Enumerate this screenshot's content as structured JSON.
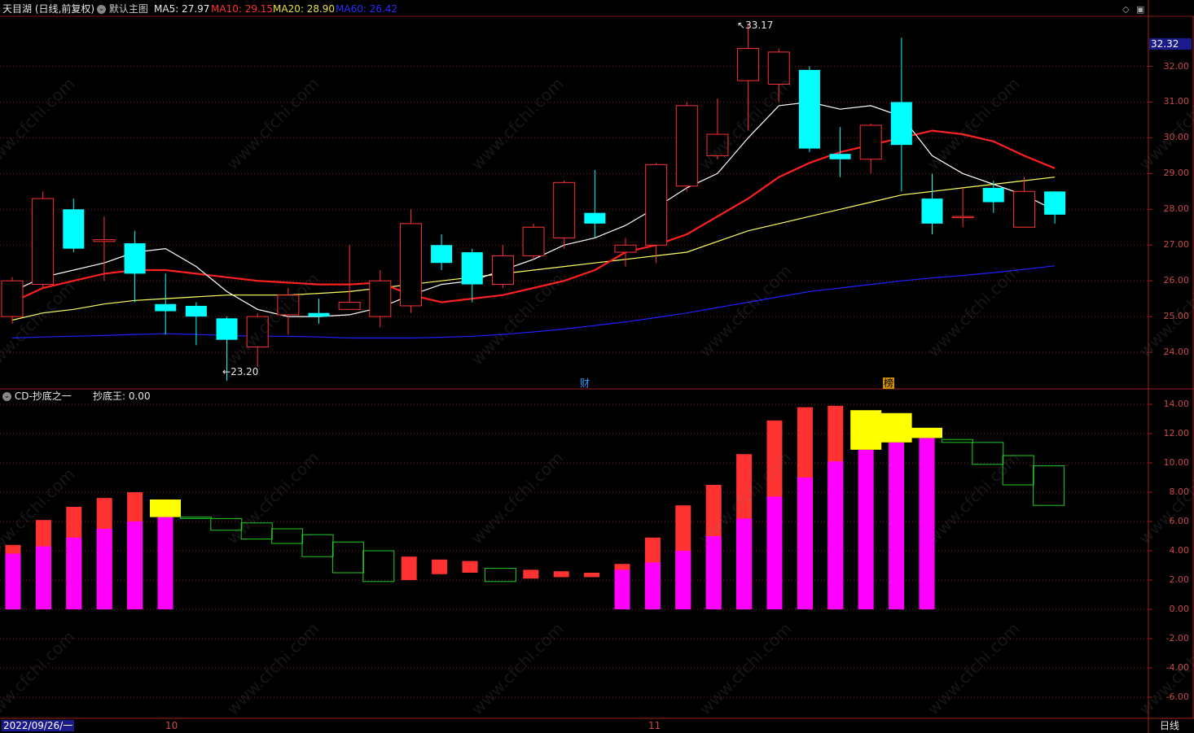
{
  "header": {
    "stock_name": "天目湖",
    "period": "(日线,前复权)",
    "main_chart_label": "默认主图",
    "ma5_label": "MA5: 27.97",
    "ma10_label": "MA10: 29.15",
    "ma20_label": "MA20: 28.90",
    "ma60_label": "MA60: 26.42"
  },
  "indicator": {
    "name": "CD-抄底之一",
    "value_label": "抄底王: 0.00"
  },
  "annotations": {
    "high": "33.17",
    "low": "23.20",
    "current_price": "32.32",
    "marker_cai": "财",
    "marker_bang": "榜"
  },
  "footer": {
    "date": "2022/09/26/一",
    "month_oct": "10",
    "month_nov": "11",
    "period_tab": "日线"
  },
  "price_axis": [
    "32.00",
    "31.00",
    "30.00",
    "29.00",
    "28.00",
    "27.00",
    "26.00",
    "25.00",
    "24.00"
  ],
  "indicator_axis": [
    "14.00",
    "12.00",
    "10.00",
    "8.00",
    "6.00",
    "4.00",
    "2.00",
    "0.00",
    "-2.00",
    "-4.00",
    "-6.00"
  ],
  "watermark": "www.cfchi.com",
  "colors": {
    "background": "#000000",
    "up": "#ff3232",
    "down": "#00ffff",
    "ma5": "#ffffff",
    "ma10": "#ff2020",
    "ma20": "#ffff60",
    "ma60": "#2020ff",
    "magenta": "#ff00ff",
    "yellow": "#ffff00",
    "green": "#22cc22",
    "grid": "#7a1818"
  },
  "chart_data": [
    {
      "type": "candlestick",
      "title": "天目湖 (日线,前复权)",
      "candles": [
        {
          "o": 25.0,
          "h": 26.1,
          "l": 24.8,
          "c": 26.0
        },
        {
          "o": 25.9,
          "h": 28.5,
          "l": 25.8,
          "c": 28.3
        },
        {
          "o": 28.0,
          "h": 28.3,
          "l": 26.8,
          "c": 26.9
        },
        {
          "o": 27.1,
          "h": 27.8,
          "l": 26.0,
          "c": 27.15
        },
        {
          "o": 27.05,
          "h": 27.4,
          "l": 25.4,
          "c": 26.2
        },
        {
          "o": 25.35,
          "h": 26.2,
          "l": 24.5,
          "c": 25.15
        },
        {
          "o": 25.3,
          "h": 25.4,
          "l": 24.2,
          "c": 25.0
        },
        {
          "o": 24.95,
          "h": 25.0,
          "l": 23.2,
          "c": 24.35
        },
        {
          "o": 24.15,
          "h": 25.1,
          "l": 23.6,
          "c": 25.0
        },
        {
          "o": 25.05,
          "h": 25.8,
          "l": 24.5,
          "c": 25.6
        },
        {
          "o": 25.1,
          "h": 25.5,
          "l": 24.8,
          "c": 25.0
        },
        {
          "o": 25.2,
          "h": 27.0,
          "l": 25.2,
          "c": 25.4
        },
        {
          "o": 25.0,
          "h": 26.3,
          "l": 24.7,
          "c": 26.0
        },
        {
          "o": 25.3,
          "h": 28.0,
          "l": 25.1,
          "c": 27.6
        },
        {
          "o": 27.0,
          "h": 27.3,
          "l": 26.3,
          "c": 26.5
        },
        {
          "o": 26.8,
          "h": 26.9,
          "l": 25.4,
          "c": 25.9
        },
        {
          "o": 25.9,
          "h": 27.0,
          "l": 25.8,
          "c": 26.7
        },
        {
          "o": 26.7,
          "h": 27.6,
          "l": 26.6,
          "c": 27.5
        },
        {
          "o": 27.2,
          "h": 28.8,
          "l": 26.9,
          "c": 28.75
        },
        {
          "o": 27.9,
          "h": 29.1,
          "l": 27.2,
          "c": 27.6
        },
        {
          "o": 26.8,
          "h": 27.2,
          "l": 26.4,
          "c": 27.0
        },
        {
          "o": 27.0,
          "h": 29.3,
          "l": 26.5,
          "c": 29.25
        },
        {
          "o": 28.65,
          "h": 31.0,
          "l": 28.5,
          "c": 30.9
        },
        {
          "o": 29.5,
          "h": 31.1,
          "l": 29.4,
          "c": 30.1
        },
        {
          "o": 31.6,
          "h": 33.17,
          "l": 30.2,
          "c": 32.5
        },
        {
          "o": 31.5,
          "h": 32.5,
          "l": 31.0,
          "c": 32.4
        },
        {
          "o": 31.9,
          "h": 32.0,
          "l": 29.6,
          "c": 29.7
        },
        {
          "o": 29.55,
          "h": 30.3,
          "l": 28.9,
          "c": 29.4
        },
        {
          "o": 29.4,
          "h": 30.4,
          "l": 29.0,
          "c": 30.35
        },
        {
          "o": 31.0,
          "h": 32.8,
          "l": 28.5,
          "c": 29.8
        },
        {
          "o": 28.3,
          "h": 29.0,
          "l": 27.3,
          "c": 27.6
        },
        {
          "o": 27.8,
          "h": 28.6,
          "l": 27.5,
          "c": 27.8
        },
        {
          "o": 28.6,
          "h": 28.8,
          "l": 27.9,
          "c": 28.2
        },
        {
          "o": 27.5,
          "h": 28.9,
          "l": 27.5,
          "c": 28.5
        },
        {
          "o": 28.5,
          "h": 28.5,
          "l": 27.6,
          "c": 27.85
        }
      ],
      "ma5": [
        25.7,
        26.1,
        26.3,
        26.5,
        26.8,
        26.9,
        26.4,
        25.7,
        25.2,
        25.0,
        25.0,
        25.05,
        25.25,
        25.6,
        25.9,
        26.0,
        26.3,
        26.6,
        27.0,
        27.2,
        27.55,
        28.05,
        28.6,
        29.0,
        30.0,
        30.9,
        31.0,
        30.8,
        30.9,
        30.6,
        29.5,
        29.0,
        28.7,
        28.4,
        27.97
      ],
      "ma10": [
        25.4,
        25.8,
        26.0,
        26.2,
        26.3,
        26.3,
        26.2,
        26.1,
        26.0,
        25.95,
        25.9,
        25.9,
        25.95,
        25.6,
        25.4,
        25.5,
        25.6,
        25.8,
        26.0,
        26.3,
        26.8,
        27.0,
        27.3,
        27.8,
        28.3,
        28.9,
        29.3,
        29.6,
        29.8,
        30.0,
        30.2,
        30.1,
        29.9,
        29.5,
        29.15
      ],
      "ma20": [
        24.9,
        25.1,
        25.2,
        25.35,
        25.45,
        25.5,
        25.55,
        25.6,
        25.6,
        25.6,
        25.65,
        25.7,
        25.8,
        25.9,
        26.0,
        26.1,
        26.2,
        26.3,
        26.4,
        26.5,
        26.6,
        26.7,
        26.8,
        27.1,
        27.4,
        27.6,
        27.8,
        28.0,
        28.2,
        28.4,
        28.5,
        28.6,
        28.7,
        28.8,
        28.9
      ],
      "ma60": [
        24.4,
        24.43,
        24.45,
        24.47,
        24.5,
        24.52,
        24.5,
        24.47,
        24.45,
        24.45,
        24.43,
        24.4,
        24.4,
        24.4,
        24.42,
        24.45,
        24.5,
        24.57,
        24.65,
        24.75,
        24.85,
        24.97,
        25.1,
        25.25,
        25.4,
        25.55,
        25.7,
        25.8,
        25.9,
        26.0,
        26.08,
        26.15,
        26.23,
        26.32,
        26.42
      ],
      "ylim": [
        23.0,
        33.4
      ]
    },
    {
      "type": "bar",
      "title": "CD-抄底之一",
      "series": [
        {
          "name": "magenta",
          "values": [
            3.8,
            4.3,
            4.9,
            5.5,
            6.0,
            6.3,
            0,
            0,
            0,
            0,
            0,
            0,
            0,
            0,
            0,
            0,
            0,
            0,
            0,
            0,
            2.7,
            3.2,
            4.0,
            5.0,
            6.2,
            7.7,
            9.0,
            10.1,
            10.9,
            11.4,
            11.7,
            0,
            0,
            0,
            0,
            0
          ]
        },
        {
          "name": "red_top",
          "values": [
            4.4,
            6.1,
            7.0,
            7.6,
            8.0,
            0,
            0,
            0,
            0,
            0,
            0,
            0,
            0,
            0,
            0,
            0,
            0,
            0,
            0,
            0,
            3.1,
            4.9,
            7.1,
            8.5,
            10.6,
            12.9,
            13.8,
            13.9,
            0,
            0,
            0,
            0,
            0,
            0,
            0,
            0
          ]
        },
        {
          "name": "yellow",
          "ranges": [
            [
              5,
              6.3,
              7.5
            ],
            [
              28,
              10.9,
              13.6
            ],
            [
              29,
              11.4,
              13.4
            ],
            [
              30,
              11.7,
              12.4
            ]
          ]
        },
        {
          "name": "small_red",
          "ranges": [
            [
              13,
              2.0,
              3.6
            ],
            [
              14,
              2.4,
              3.4
            ],
            [
              15,
              2.5,
              3.3
            ],
            [
              17,
              2.1,
              2.7
            ],
            [
              18,
              2.2,
              2.6
            ],
            [
              19,
              2.2,
              2.5
            ]
          ]
        },
        {
          "name": "green_box",
          "ranges": [
            [
              6,
              6.2,
              6.3
            ],
            [
              7,
              5.4,
              6.2
            ],
            [
              8,
              4.8,
              5.9
            ],
            [
              9,
              4.5,
              5.5
            ],
            [
              10,
              3.6,
              5.1
            ],
            [
              11,
              2.5,
              4.6
            ],
            [
              12,
              1.9,
              4.0
            ],
            [
              16,
              1.9,
              2.8
            ],
            [
              31,
              11.4,
              11.6
            ],
            [
              32,
              9.9,
              11.4
            ],
            [
              33,
              8.5,
              10.5
            ],
            [
              34,
              7.1,
              9.8
            ]
          ]
        }
      ],
      "ylim": [
        -7.0,
        14.5
      ]
    }
  ]
}
